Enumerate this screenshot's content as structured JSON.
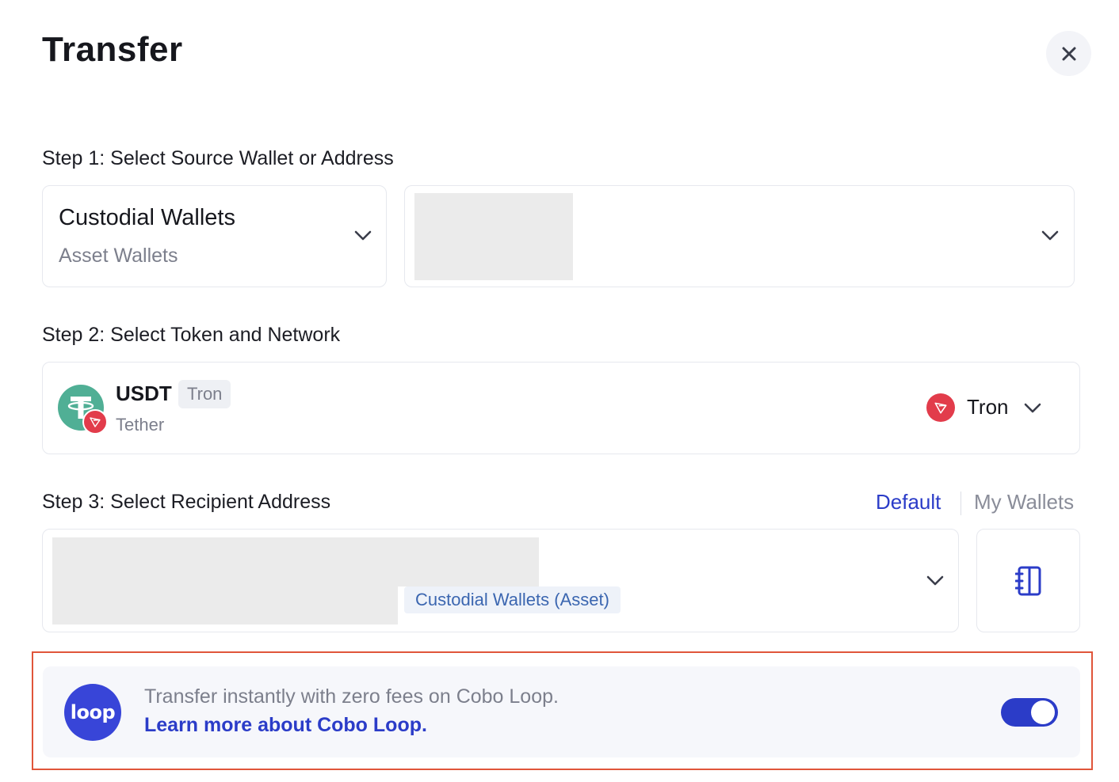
{
  "header": {
    "title": "Transfer",
    "close_icon": "close-icon"
  },
  "step1": {
    "label": "Step 1: Select Source Wallet or Address",
    "wallet_type": {
      "title": "Custodial Wallets",
      "subtitle": "Asset Wallets"
    }
  },
  "step2": {
    "label": "Step 2: Select Token and Network",
    "token": {
      "symbol": "USDT",
      "chain_chip": "Tron",
      "name": "Tether",
      "icon": "tether-icon",
      "badge_icon": "tron-icon"
    },
    "network": {
      "name": "Tron",
      "icon": "tron-icon"
    }
  },
  "step3": {
    "label": "Step 3: Select Recipient Address",
    "tabs": {
      "default": "Default",
      "my_wallets": "My Wallets"
    },
    "recipient_tag": "Custodial Wallets (Asset)",
    "address_book_icon": "address-book-icon"
  },
  "loop": {
    "logo_text": "loop",
    "message": "Transfer instantly with zero fees on Cobo Loop.",
    "link": "Learn more about Cobo Loop.",
    "toggle_on": true
  },
  "colors": {
    "accent": "#2b3cc8",
    "tron_red": "#e23c4b",
    "tether_green": "#50af95",
    "highlight_border": "#e0553a"
  }
}
